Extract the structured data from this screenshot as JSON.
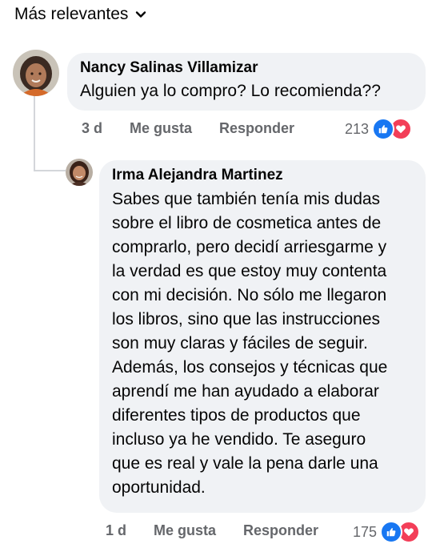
{
  "sort": {
    "label": "Más relevantes",
    "icon": "chevron-down-icon"
  },
  "comments": [
    {
      "author": "Nancy Salinas Villamizar",
      "text": "Alguien ya lo compro? Lo recomienda??",
      "time": "3 d",
      "like_label": "Me gusta",
      "reply_label": "Responder",
      "reaction_count": "213",
      "reaction_icons": [
        "like-icon",
        "love-icon"
      ]
    },
    {
      "author": "Irma Alejandra Martinez",
      "text_lines": [
        "Sabes que también tenía mis dudas",
        "sobre el libro de cosmetica antes de",
        "comprarlo, pero decidí arriesgarme y",
        "la verdad es que estoy muy contenta",
        "con mi decisión. No sólo me llegaron",
        "los libros, sino que las instrucciones",
        "son muy claras y fáciles de seguir.",
        "Además, los consejos y técnicas que",
        "aprendí me han ayudado a elaborar",
        "diferentes tipos de productos que",
        "incluso ya he vendido. Te aseguro",
        "que es real y vale la pena darle una",
        "oportunidad."
      ],
      "time": "1 d",
      "like_label": "Me gusta",
      "reply_label": "Responder",
      "reaction_count": "175",
      "reaction_icons": [
        "like-icon",
        "love-icon"
      ]
    }
  ],
  "colors": {
    "bubble": "#f0f2f5",
    "meta_text": "#65676b",
    "like": "#1877f2",
    "love": "#f33e58"
  }
}
